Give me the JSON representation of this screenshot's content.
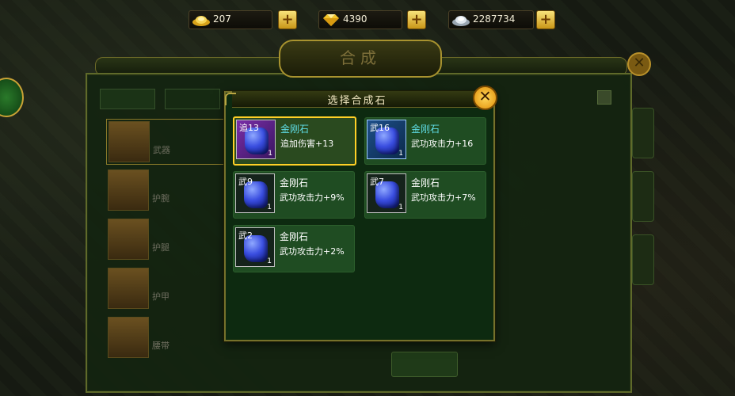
{
  "topbar": {
    "gold": {
      "value": "207",
      "icon": "gold-ingot-icon"
    },
    "diamond": {
      "value": "4390",
      "icon": "gold-diamond-icon"
    },
    "silver": {
      "value": "2287734",
      "icon": "silver-ingot-icon"
    },
    "plus_label": "+"
  },
  "outer_panel": {
    "title": "合成",
    "close_label": "✕",
    "list": [
      {
        "sub": "武器"
      },
      {
        "sub": "护腕"
      },
      {
        "sub": "护腿"
      },
      {
        "sub": "护甲"
      },
      {
        "sub": "腰带"
      }
    ]
  },
  "dialog": {
    "title": "选择合成石",
    "close_label": "✕",
    "items": [
      {
        "tag": "追13",
        "count": "1",
        "name": "金刚石",
        "desc": "追加伤害+13",
        "selected": true,
        "slot_color": "purple"
      },
      {
        "tag": "武16",
        "count": "1",
        "name": "金刚石",
        "desc": "武功攻击力+16",
        "selected": false,
        "slot_color": "blue"
      },
      {
        "tag": "武9",
        "count": "1",
        "name": "金刚石",
        "desc": "武功攻击力+9%",
        "selected": false,
        "slot_color": "plain"
      },
      {
        "tag": "武7",
        "count": "1",
        "name": "金刚石",
        "desc": "武功攻击力+7%",
        "selected": false,
        "slot_color": "plain"
      },
      {
        "tag": "武2",
        "count": "1",
        "name": "金刚石",
        "desc": "武功攻击力+2%",
        "selected": false,
        "slot_color": "plain"
      }
    ]
  },
  "colors": {
    "accent_gold": "#ffd026",
    "panel_green": "#1f4c22",
    "cyan_name": "#5fdde6"
  }
}
